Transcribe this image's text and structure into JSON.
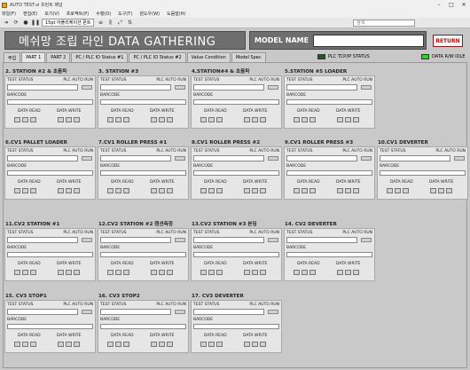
{
  "window": {
    "title": "AUTO TEST.vi 프런트 패널"
  },
  "menu": [
    "파일(F)",
    "편집(E)",
    "보기(V)",
    "프로젝트(P)",
    "수행(O)",
    "도구(T)",
    "윈도우(W)",
    "도움말(H)"
  ],
  "toolbar": {
    "font": "15pt 어플리케이션 폰트",
    "search_placeholder": "검색"
  },
  "header": {
    "title": "메쉬망 조립 라인  DATA GATHERING",
    "model_label": "MODEL NAME",
    "model_value": "",
    "return_label": "RETURN"
  },
  "tabs": [
    "주입",
    "PART 1",
    "PART 2",
    "PC / PLC IO Status #1",
    "PC / PLC IO Status #2",
    "Value Condition",
    "Model Spec"
  ],
  "status": {
    "plc_tcp": "PLC TCP/IP STATUS",
    "data_rw": "DATA R/W IDLE",
    "plc_color": "#1d5e1d",
    "data_color": "#2fd12f"
  },
  "panel_labels": {
    "test_status": "TEST STATUS",
    "plc_auto_run": "PLC AUTO RUN",
    "barcode": "BARCODE",
    "data_read": "DATA READ",
    "data_write": "DATA WRITE"
  },
  "panels": [
    {
      "title": "2. STATION #2 & 초음파"
    },
    {
      "title": "3. STATION #3"
    },
    {
      "title": "4.STATION#4 & 초음파"
    },
    {
      "title": "5.STATION #5 LOADER"
    },
    {
      "title": "6.CV1 PALLET LOADER"
    },
    {
      "title": "7.CV1 ROLLER PRESS #1"
    },
    {
      "title": "8.CV1 ROLLER PRESS #2"
    },
    {
      "title": "9.CV1 ROLLER PRESS #3"
    },
    {
      "title": "10.CV1 DEVERTER"
    },
    {
      "title": "11.CV2 STATION #1"
    },
    {
      "title": "12.CV2 STATION #2 텐션측정"
    },
    {
      "title": "13.CV2 STATION #3 본딩"
    },
    {
      "title": "14. CV2 DEVERTER"
    },
    {
      "title": "15. CV3 STOP1"
    },
    {
      "title": "16. CV3 STOP2"
    },
    {
      "title": "17. CV3 DEVERTER"
    }
  ]
}
